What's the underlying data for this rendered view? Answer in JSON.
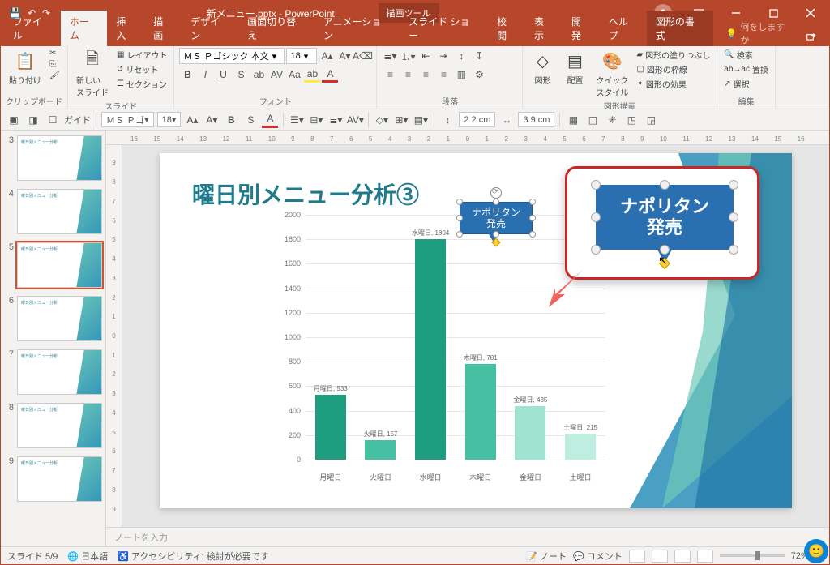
{
  "app": {
    "title": "新メニュー.pptx - PowerPoint",
    "context_tool": "描画ツール"
  },
  "tabs": {
    "file": "ファイル",
    "home": "ホーム",
    "insert": "挿入",
    "draw": "描画",
    "design": "デザイン",
    "transitions": "画面切り替え",
    "animations": "アニメーション",
    "slideshow": "スライド ショー",
    "review": "校閲",
    "view": "表示",
    "developer": "開発",
    "help": "ヘルプ",
    "format": "図形の書式",
    "tellme": "何をしますか"
  },
  "ribbon": {
    "clipboard": {
      "paste": "貼り付け",
      "group": "クリップボード"
    },
    "slides": {
      "new": "新しい\nスライド",
      "layout": "レイアウト",
      "reset": "リセット",
      "section": "セクション",
      "group": "スライド"
    },
    "font": {
      "name": "ＭＳ Ｐゴシック 本文",
      "size": "18",
      "group": "フォント"
    },
    "paragraph": {
      "group": "段落"
    },
    "drawing": {
      "shapes": "図形",
      "arrange": "配置",
      "quick": "クイック\nスタイル",
      "fill": "図形の塗りつぶし",
      "outline": "図形の枠線",
      "effects": "図形の効果",
      "group": "図形描画"
    },
    "editing": {
      "find": "検索",
      "replace": "置換",
      "select": "選択",
      "group": "編集"
    }
  },
  "toolbar2": {
    "guide": "ガイド",
    "font": "ＭＳ Ｐゴ",
    "size": "18",
    "w": "2.2 cm",
    "h": "3.9 cm"
  },
  "ruler_h": [
    "16",
    "15",
    "14",
    "13",
    "12",
    "11",
    "10",
    "9",
    "8",
    "7",
    "6",
    "5",
    "4",
    "3",
    "2",
    "1",
    "0",
    "1",
    "2",
    "3",
    "4",
    "5",
    "6",
    "7",
    "8",
    "9",
    "10",
    "11",
    "12",
    "13",
    "14",
    "15",
    "16"
  ],
  "ruler_v": [
    "9",
    "8",
    "7",
    "6",
    "5",
    "4",
    "3",
    "2",
    "1",
    "0",
    "1",
    "2",
    "3",
    "4",
    "5",
    "6",
    "7",
    "8",
    "9"
  ],
  "thumbs": [
    3,
    4,
    5,
    6,
    7,
    8,
    9
  ],
  "slide": {
    "title": "曜日別メニュー分析③",
    "callout_text": "ナポリタン\n発売",
    "anno_text": "ナポリタン\n発売"
  },
  "chart_data": {
    "type": "bar",
    "title": "",
    "xlabel": "",
    "ylabel": "",
    "ylim": [
      0,
      2000
    ],
    "ytick_step": 200,
    "categories": [
      "月曜日",
      "火曜日",
      "水曜日",
      "木曜日",
      "金曜日",
      "土曜日"
    ],
    "values": [
      533,
      157,
      1804,
      781,
      435,
      215
    ],
    "data_labels": [
      "月曜日, 533",
      "火曜日, 157",
      "水曜日, 1804",
      "木曜日, 781",
      "金曜日, 435",
      "土曜日, 215"
    ],
    "colors": [
      "#1e9e7f",
      "#46c0a3",
      "#1e9e7f",
      "#46c0a3",
      "#9fe3d0",
      "#bfeee0"
    ]
  },
  "notes": {
    "placeholder": "ノートを入力"
  },
  "status": {
    "slide_pos": "スライド 5/9",
    "lang": "日本語",
    "a11y": "アクセシビリティ: 検討が必要です",
    "notes_btn": "ノート",
    "comments_btn": "コメント",
    "zoom": "72%"
  }
}
